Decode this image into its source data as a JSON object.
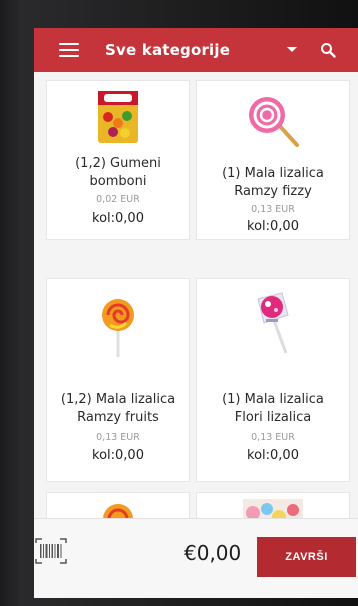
{
  "header": {
    "title": "Sve kategorije"
  },
  "products": [
    {
      "name_line1": "(1,2) Gumeni",
      "name_line2": "bomboni",
      "price": "0,02 EUR",
      "qty": "kol:0,00",
      "image": "haribo-gummy-bag"
    },
    {
      "name_line1": "(1) Mala lizalica",
      "name_line2": "Ramzy fizzy",
      "price": "0,13 EUR",
      "qty": "kol:0,00",
      "image": "pink-swirl-lollipop"
    },
    {
      "name_line1": "(1,2) Mala lizalica",
      "name_line2": "Ramzy fruits",
      "price": "0,13 EUR",
      "qty": "kol:0,00",
      "image": "orange-swirl-lollipop"
    },
    {
      "name_line1": "(1) Mala lizalica",
      "name_line2": "Flori lizalica",
      "price": "0,13 EUR",
      "qty": "kol:0,00",
      "image": "wrapped-lollipop"
    },
    {
      "image": "orange-swirl-lollipop"
    },
    {
      "image": "colorful-candies"
    }
  ],
  "footer": {
    "total": "€0,00",
    "finish_label": "ZAVRŠI"
  },
  "colors": {
    "header_bg": "#c5343b",
    "finish_bg": "#b32a31"
  }
}
